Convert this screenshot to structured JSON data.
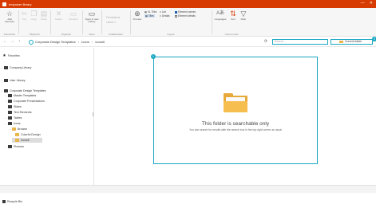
{
  "window": {
    "title": "empower library",
    "minimize": "—",
    "close": "✕"
  },
  "ribbon": {
    "groups": {
      "favourites": "Favourites",
      "clipboard": "Clipboard",
      "organize": "Organize",
      "open": "Open",
      "collaboration": "Collaboration",
      "layout": "Layout",
      "current_view": "Current view"
    },
    "buttons": {
      "add_favourite": "Add favourite",
      "cut": "Cut",
      "copy": "Copy",
      "paste": "Paste",
      "delete": "Delete",
      "rename": "Rename",
      "open_new_library": "Open in new Library",
      "permissions": "Permissions",
      "labels": "Labels",
      "preview": "Preview",
      "xl_tiles": "XL Tiles",
      "tiles": "Tiles",
      "list": "List",
      "details": "Details",
      "element_names": "Element names",
      "element_details": "Element details",
      "languages": "Languages",
      "sort": "Sort",
      "filter": "Filter"
    }
  },
  "address": {
    "crumbs": [
      "Corporate Design Templates",
      "Icons",
      "Iconoll"
    ],
    "separator": "›",
    "search_placeholder": "Search...",
    "scope": "Current folder",
    "back": "←",
    "forward": "→",
    "up": "↑",
    "refresh": "⟳"
  },
  "markers": {
    "a": "1",
    "b": "2"
  },
  "sidebar": {
    "favorites": "Favorites",
    "company_library": "Company Library",
    "user_library": "User Library",
    "corporate_design_templates": "Corporate Design Templates",
    "master_templates": "Master Templates",
    "corporate_presentations": "Corporate Presentations",
    "slides": "Slides",
    "text_elements": "Text Elements",
    "tables": "Tables",
    "icons": "Icons",
    "browse": "Browse",
    "colorful_design": "Colorful Design",
    "iconoll": "Iconoll",
    "pictures": "Pictures",
    "recycle_bin": "Recycle Bin"
  },
  "main": {
    "empty_title": "This folder is searchable only",
    "empty_subtitle": "You can search for results with the search box in the top right corner as usual"
  },
  "colors": {
    "accent": "#19a7c3",
    "titlebar": "#d83b01",
    "folder": "#f6bd4f"
  }
}
